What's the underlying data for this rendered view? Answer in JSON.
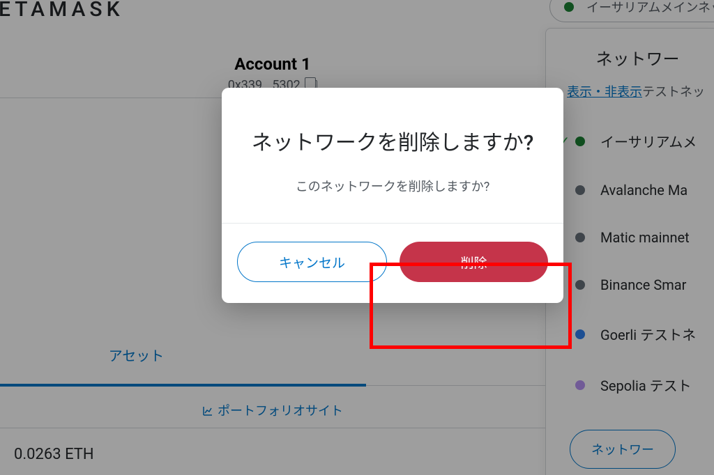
{
  "brand": "ETAMASK",
  "account": {
    "name": "Account 1",
    "address": "0x339...5302"
  },
  "tabs": {
    "assets": "アセット"
  },
  "portfolio_link": "ポートフォリオサイト",
  "balance": "0.0263 ETH",
  "current_network_pill": "イーサリアムメインネッ",
  "panel": {
    "title": "ネットワー",
    "show_hide": "表示・非表示",
    "test_suffix": "テストネッ",
    "networks": [
      {
        "label": "イーサリアムメ",
        "color": "#1c8234",
        "selected": true
      },
      {
        "label": "Avalanche Ma",
        "color": "#6a737d",
        "selected": false
      },
      {
        "label": "Matic mainnet",
        "color": "#6a737d",
        "selected": false
      },
      {
        "label": "Binance Smar",
        "color": "#6a737d",
        "selected": false
      },
      {
        "label": "Goerli テストネ",
        "color": "#2f80ed",
        "selected": false
      },
      {
        "label": "Sepolia テスト",
        "color": "#b794f4",
        "selected": false
      }
    ],
    "add_network": "ネットワー"
  },
  "modal": {
    "title": "ネットワークを削除しますか?",
    "body": "このネットワークを削除しますか?",
    "cancel": "キャンセル",
    "confirm": "削除"
  },
  "colors": {
    "pill_dot": "#1c8234"
  }
}
